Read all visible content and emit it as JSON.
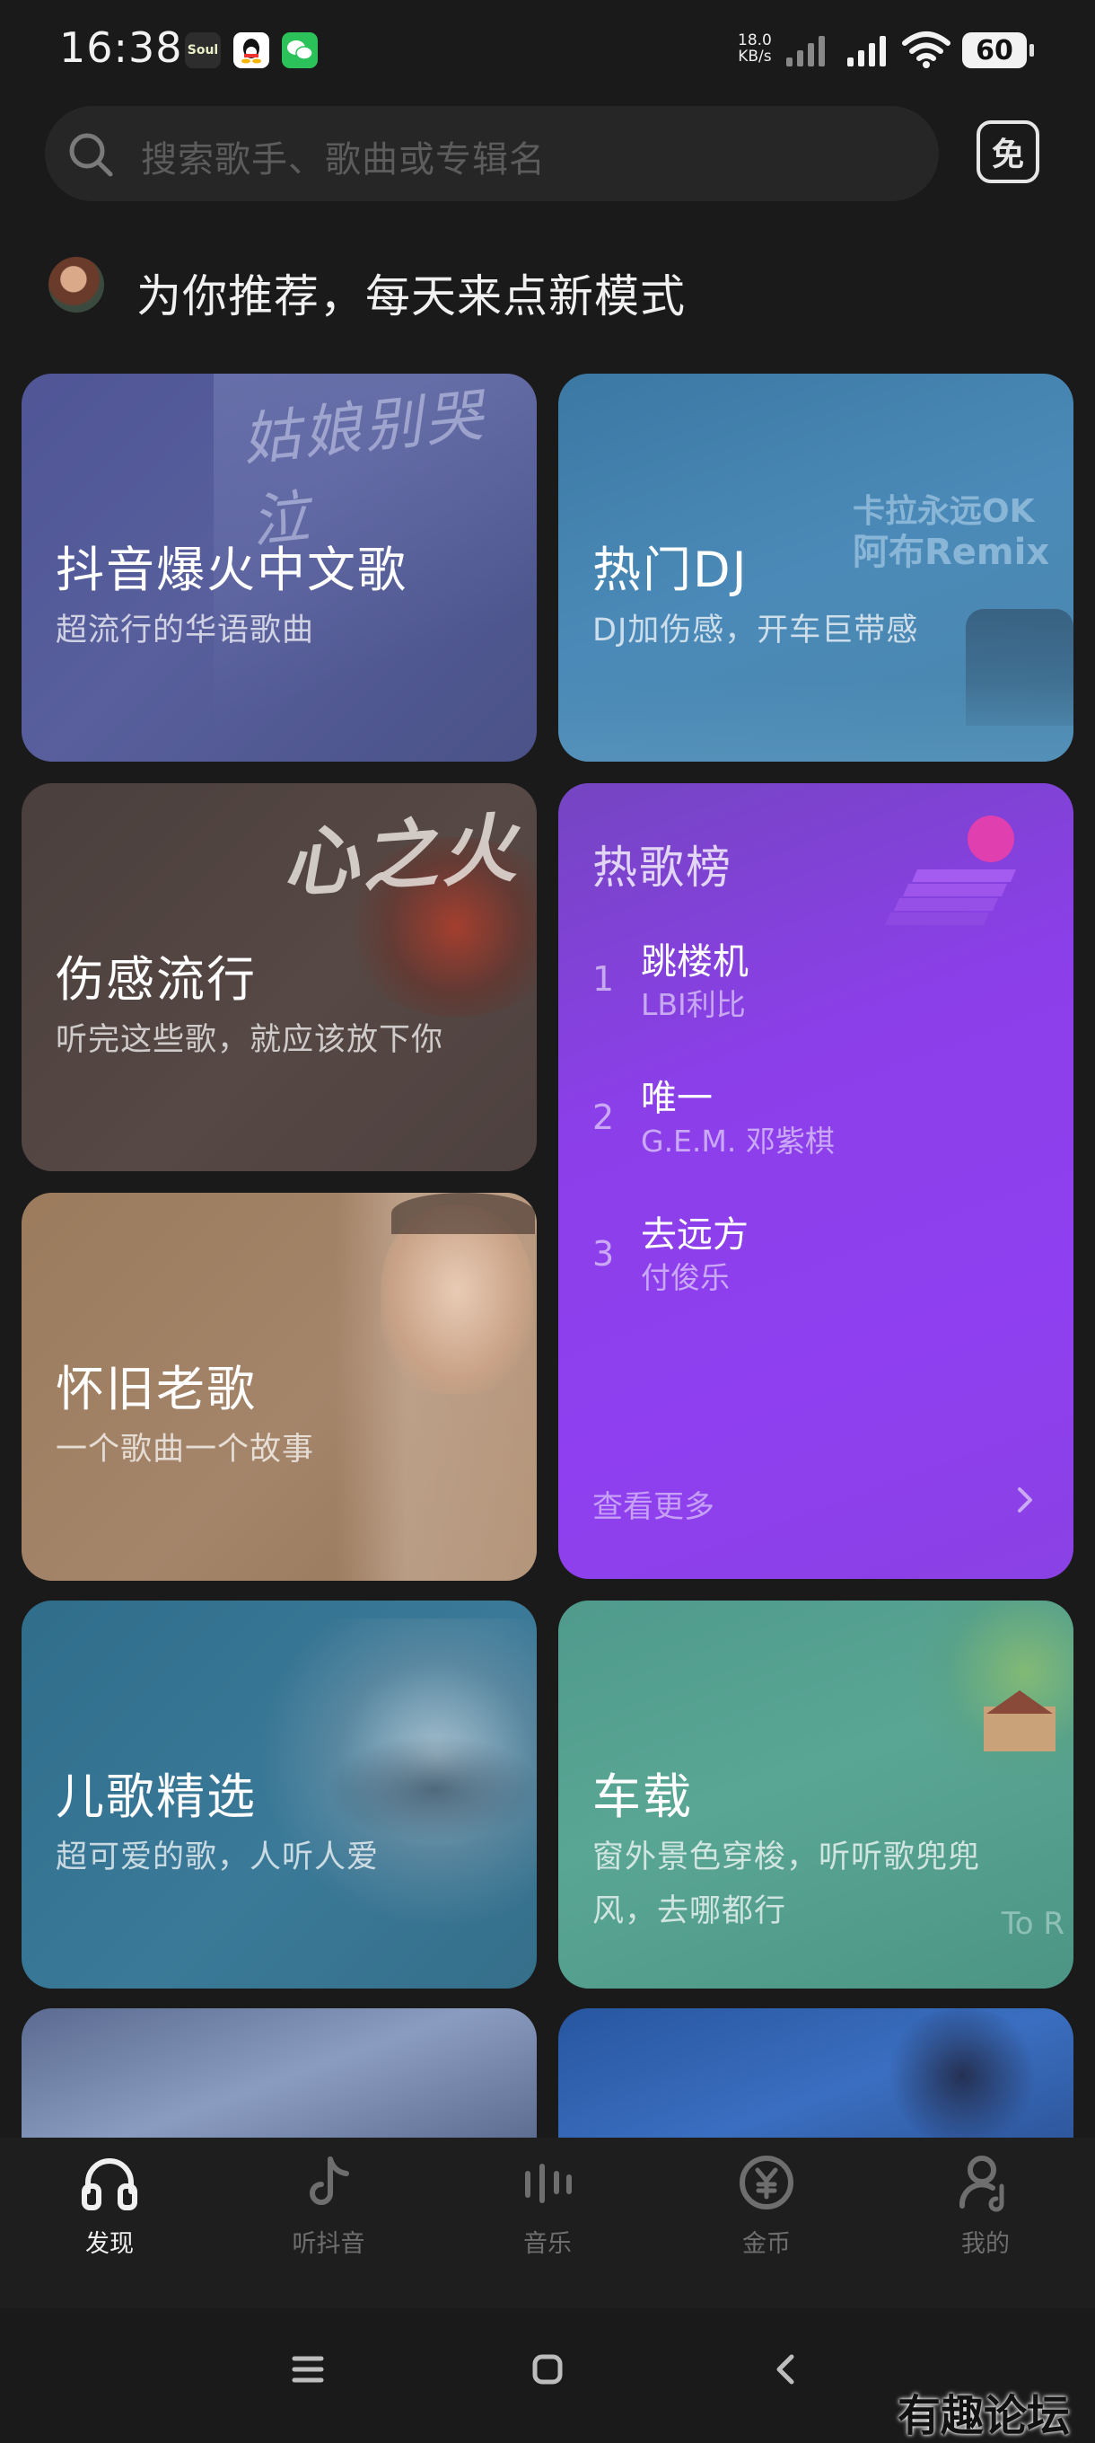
{
  "status": {
    "time": "16:38",
    "apps": [
      "Soul",
      "QQ",
      "WeChat"
    ],
    "net_speed_value": "18.0",
    "net_speed_unit": "KB/s",
    "battery": "60"
  },
  "search": {
    "placeholder": "搜索歌手、歌曲或专辑名",
    "free_label": "免"
  },
  "recommend": {
    "title": "为你推荐，每天来点新模式"
  },
  "cards": {
    "douyin": {
      "title": "抖音爆火中文歌",
      "subtitle": "超流行的华语歌曲",
      "art_text": "姑娘别哭泣"
    },
    "dj": {
      "title": "热门DJ",
      "subtitle": "DJ加伤感，开车巨带感",
      "art_line1": "卡拉永远OK",
      "art_line2": "阿布Remix"
    },
    "sad": {
      "title": "伤感流行",
      "subtitle": "听完这些歌，就应该放下你",
      "art_text": "心之火"
    },
    "oldies": {
      "title": "怀旧老歌",
      "subtitle": "一个歌曲一个故事"
    },
    "kids": {
      "title": "儿歌精选",
      "subtitle": "超可爱的歌，人听人爱"
    },
    "car": {
      "title": "车载",
      "subtitle_line1": "窗外景色穿梭，听听歌兜兜",
      "subtitle_line2": "风，去哪都行",
      "art_text": "To R"
    }
  },
  "hot_chart": {
    "title": "热歌榜",
    "songs": [
      {
        "rank": "1",
        "name": "跳楼机",
        "artist": "LBI利比"
      },
      {
        "rank": "2",
        "name": "唯一",
        "artist": "G.E.M. 邓紫棋"
      },
      {
        "rank": "3",
        "name": "去远方",
        "artist": "付俊乐"
      }
    ],
    "more_label": "查看更多"
  },
  "nav": {
    "items": [
      {
        "label": "发现",
        "icon": "headphones-icon",
        "active": true
      },
      {
        "label": "听抖音",
        "icon": "tiktok-note-icon",
        "active": false
      },
      {
        "label": "音乐",
        "icon": "music-bars-icon",
        "active": false
      },
      {
        "label": "金币",
        "icon": "coin-icon",
        "active": false
      },
      {
        "label": "我的",
        "icon": "profile-icon",
        "active": false
      }
    ]
  },
  "watermark": "有趣论坛",
  "colors": {
    "background": "#1a1a1a",
    "hot_chart_purple": "#8b3fe8",
    "active_nav": "#f0f0f0",
    "inactive_nav": "#6e6e6e"
  }
}
